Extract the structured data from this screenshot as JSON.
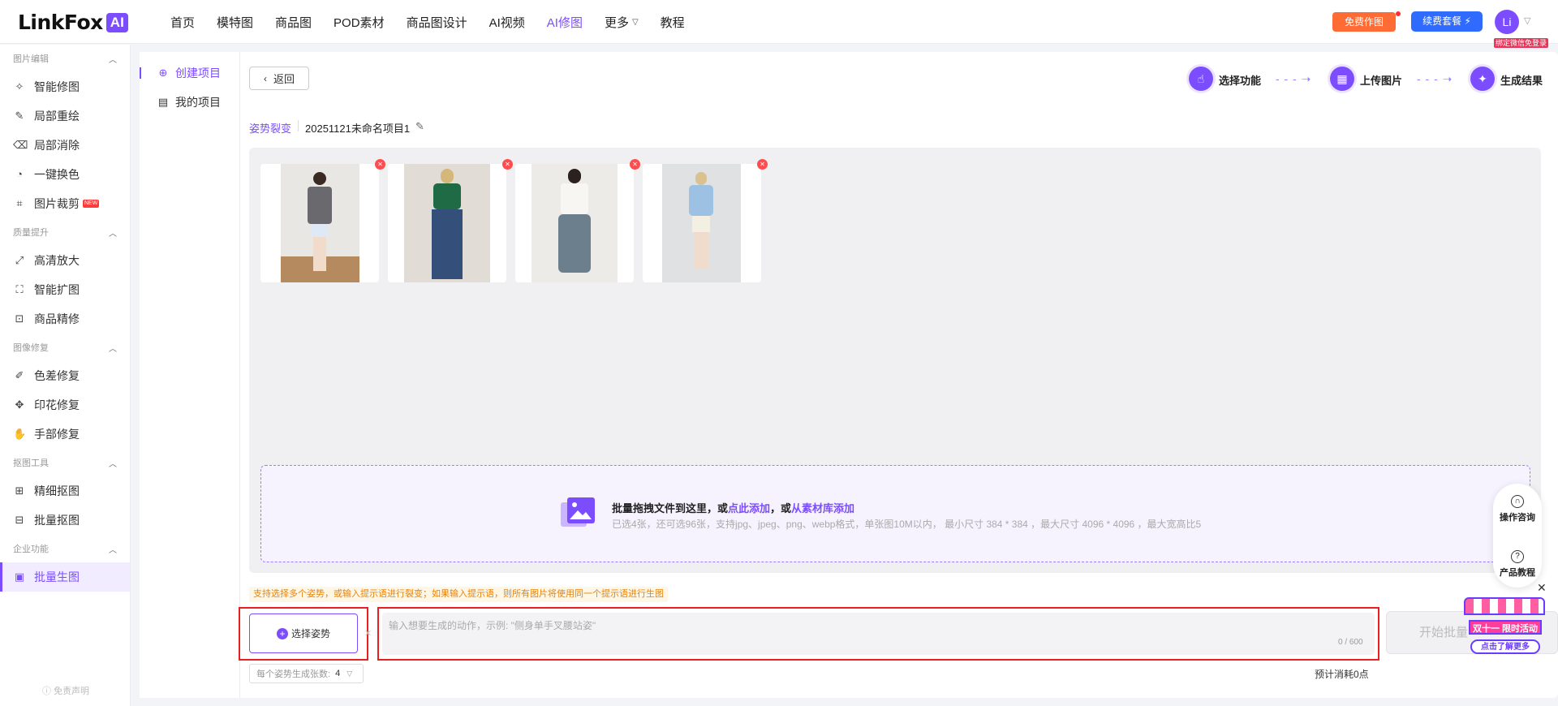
{
  "header": {
    "logo_text": "LinkFox",
    "logo_badge": "AI",
    "nav": [
      {
        "label": "首页"
      },
      {
        "label": "模特图"
      },
      {
        "label": "商品图"
      },
      {
        "label": "POD素材"
      },
      {
        "label": "商品图设计"
      },
      {
        "label": "AI视频"
      },
      {
        "label": "AI修图",
        "active": true
      },
      {
        "label": "更多"
      },
      {
        "label": "教程"
      }
    ],
    "free_btn": "免费作图",
    "renew_btn": "续费套餐",
    "avatar": "Li",
    "bind_badge": "绑定微信免登录"
  },
  "sidebar": {
    "groups": [
      {
        "title": "图片编辑",
        "items": [
          {
            "label": "智能修图",
            "icon": "wand-icon"
          },
          {
            "label": "局部重绘",
            "icon": "edit-icon"
          },
          {
            "label": "局部消除",
            "icon": "eraser-icon"
          },
          {
            "label": "一键换色",
            "icon": "color-swap-icon"
          },
          {
            "label": "图片裁剪",
            "icon": "crop-icon",
            "badge": "NEW"
          }
        ]
      },
      {
        "title": "质量提升",
        "items": [
          {
            "label": "高清放大",
            "icon": "upscale-icon"
          },
          {
            "label": "智能扩图",
            "icon": "expand-icon"
          },
          {
            "label": "商品精修",
            "icon": "refine-icon"
          }
        ]
      },
      {
        "title": "图像修复",
        "items": [
          {
            "label": "色差修复",
            "icon": "color-fix-icon"
          },
          {
            "label": "印花修复",
            "icon": "pattern-fix-icon"
          },
          {
            "label": "手部修复",
            "icon": "hand-icon"
          }
        ]
      },
      {
        "title": "抠图工具",
        "items": [
          {
            "label": "精细抠图",
            "icon": "cutout-icon"
          },
          {
            "label": "批量抠图",
            "icon": "batch-cutout-icon"
          }
        ]
      },
      {
        "title": "企业功能",
        "items": [
          {
            "label": "批量生图",
            "icon": "image-icon",
            "active": true
          }
        ]
      }
    ],
    "footer": "免责声明"
  },
  "project_nav": {
    "create": "创建项目",
    "mine": "我的项目"
  },
  "toolbar": {
    "back": "返回"
  },
  "steps": [
    {
      "label": "选择功能"
    },
    {
      "label": "上传图片"
    },
    {
      "label": "生成结果"
    }
  ],
  "breadcrumb": {
    "feature": "姿势裂变",
    "project_name": "20251121未命名项目1"
  },
  "upload": {
    "title_prefix": "批量拖拽文件到这里，或",
    "link_add": "点此添加",
    "title_mid": "，或",
    "link_library": "从素材库添加",
    "subtitle": "已选4张，还可选96张，支持jpg、jpeg、png、webp格式，单张图10M以内， 最小尺寸 384 * 384 ，最大尺寸 4096 * 4096 ，最大宽高比5"
  },
  "tip": "支持选择多个姿势，或输入提示语进行裂变；如果输入提示语，则所有图片将使用同一个提示语进行生图",
  "pose": {
    "button": "选择姿势"
  },
  "prompt": {
    "placeholder": "输入想要生成的动作，示例: \"侧身单手叉腰站姿\"",
    "count": "0 / 600"
  },
  "start_button": "开始批量",
  "per_pose": {
    "label": "每个姿势生成张数:",
    "value": "4"
  },
  "cost": "预计消耗0点",
  "help": {
    "consult": "操作咨询",
    "tutorial": "产品教程"
  },
  "promo": {
    "banner": "双十一 限时活动",
    "button": "点击了解更多"
  },
  "colors": {
    "accent": "#7c4dff",
    "highlight_border": "#e61f1f",
    "free_btn": "#ff6b35",
    "renew_btn": "#2f6bff"
  }
}
